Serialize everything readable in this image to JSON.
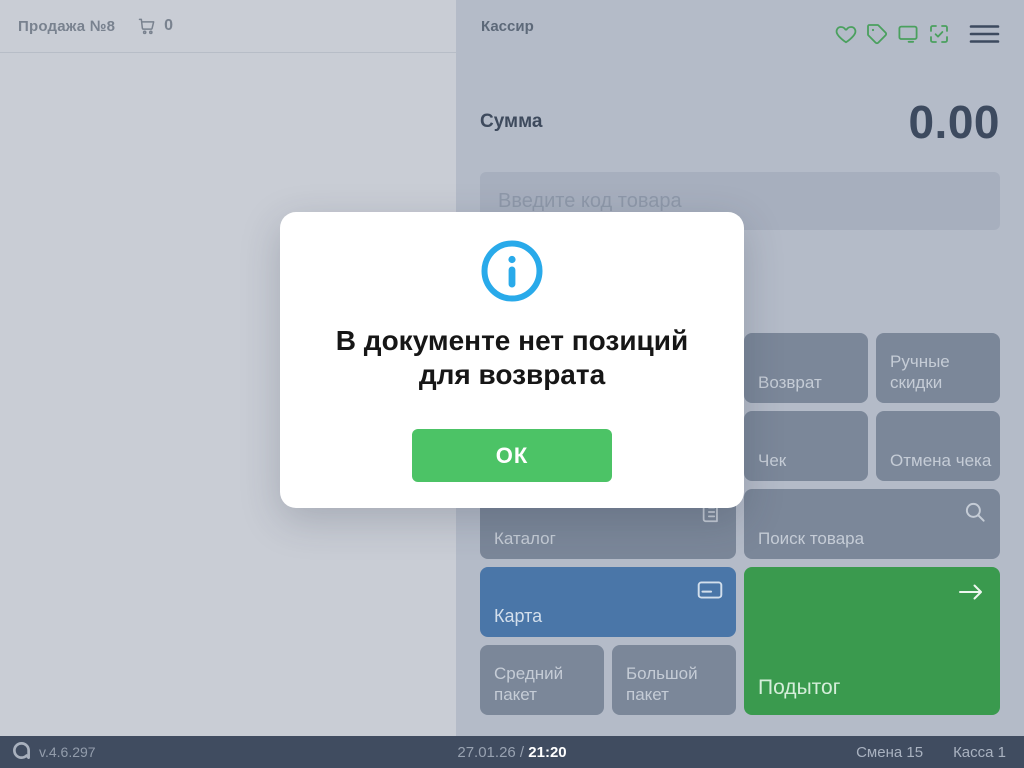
{
  "left_panel": {
    "tab_title": "Продажа №8",
    "cart_count": "0"
  },
  "right_panel": {
    "cashier_label": "Кассир",
    "toolbar_icons": [
      "heart-icon",
      "tag-icon",
      "display-icon",
      "scan-check-icon",
      "menu-icon"
    ],
    "sum_label": "Сумма",
    "sum_value": "0.00",
    "item_code_placeholder": "Введите код товара",
    "buttons": {
      "vozvrat": "Возврат",
      "ruchnye_skidki": "Ручные скидки",
      "chek": "Чек",
      "otmena_cheka": "Отмена чека",
      "katalog": "Каталог",
      "poisk_tovara": "Поиск товара",
      "karta": "Карта",
      "sredniy_paket": "Средний пакет",
      "bolshoy_paket": "Большой пакет",
      "podytog": "Подытог"
    }
  },
  "modal": {
    "icon": "info-icon",
    "message_line1": "В документе нет позиций",
    "message_line2": "для возврата",
    "ok_label": "ОК"
  },
  "status_bar": {
    "version": "v.4.6.297",
    "date": "27.01.26",
    "separator": " / ",
    "time": "21:20",
    "shift": "Смена 15",
    "register": "Касса 1"
  },
  "colors": {
    "left_panel_bg": "#c9cdd5",
    "right_panel_bg": "#b4bbc8",
    "input_bg": "#a7afbe",
    "button_gray": "#7b8799",
    "button_blue": "#4a76a8",
    "button_green": "#3a9a4e",
    "ok_green": "#4cc366",
    "toolbar_icon_green": "#4aa05e",
    "info_blue": "#29aaea",
    "dark_navy": "#3d4a5f",
    "status_bar_bg": "#404c60"
  }
}
